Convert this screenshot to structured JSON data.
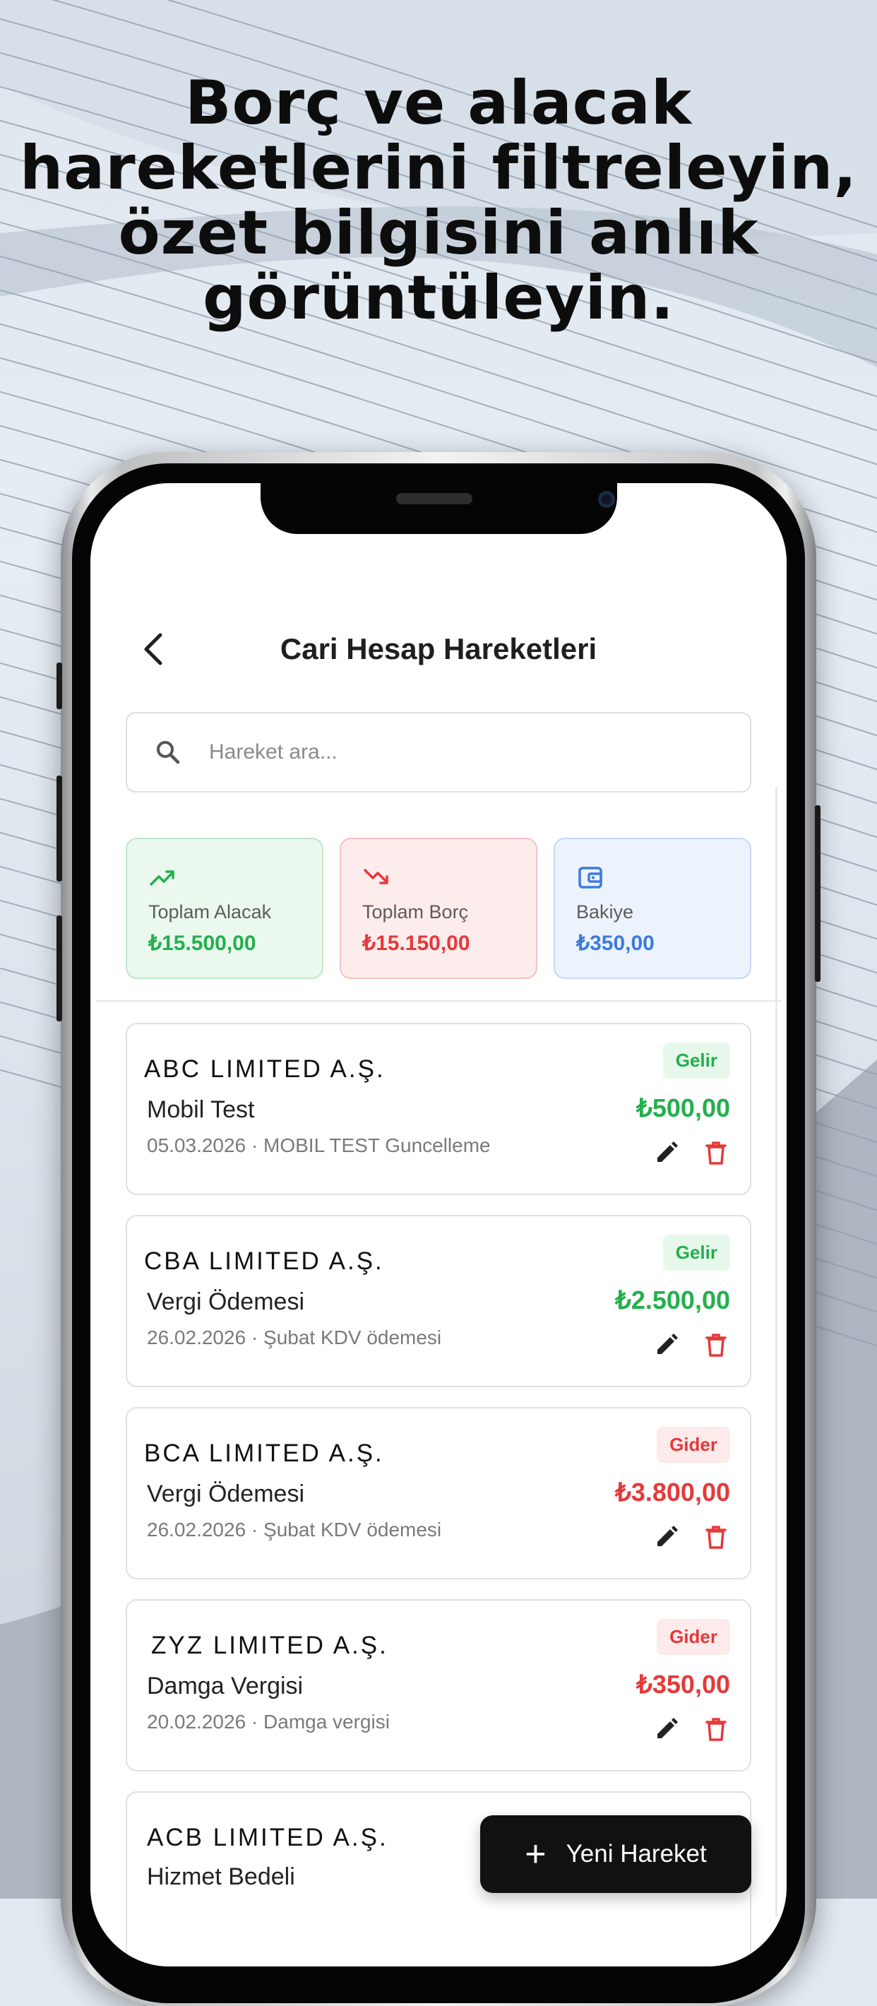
{
  "promo": {
    "headline_lines": [
      "Borç ve alacak",
      "hareketlerini filtreleyin,",
      "özet bilgisini anlık",
      "görüntüleyin."
    ]
  },
  "header": {
    "title": "Cari Hesap Hareketleri",
    "back_icon": "chevron-left-icon"
  },
  "search": {
    "placeholder": "Hareket ara...",
    "value": ""
  },
  "summary": [
    {
      "label": "Toplam Alacak",
      "value": "₺15.500,00",
      "icon": "trending-up-icon",
      "color": "#22b04b"
    },
    {
      "label": "Toplam Borç",
      "value": "₺15.150,00",
      "icon": "trending-down-icon",
      "color": "#e5393b"
    },
    {
      "label": "Bakiye",
      "value": "₺350,00",
      "icon": "wallet-icon",
      "color": "#3a7be0"
    }
  ],
  "transactions": [
    {
      "company": "ABC LIMITED A.Ş.",
      "title": "Mobil Test",
      "meta": "05.03.2026 · MOBIL TEST Guncelleme",
      "type": "Gelir",
      "amount": "₺500,00"
    },
    {
      "company": "CBA LIMITED A.Ş.",
      "title": "Vergi Ödemesi",
      "meta": "26.02.2026 · Şubat KDV ödemesi",
      "type": "Gelir",
      "amount": "₺2.500,00"
    },
    {
      "company": "BCA LIMITED A.Ş.",
      "title": "Vergi Ödemesi",
      "meta": "26.02.2026 · Şubat KDV ödemesi",
      "type": "Gider",
      "amount": "₺3.800,00"
    },
    {
      "company": "ZYZ LIMITED A.Ş.",
      "title": "Damga Vergisi",
      "meta": "20.02.2026 · Damga vergisi",
      "type": "Gider",
      "amount": "₺350,00"
    },
    {
      "company": "ACB LIMITED A.Ş.",
      "title": "Hizmet Bedeli",
      "meta": "",
      "type": "",
      "amount": ""
    }
  ],
  "fab": {
    "label": "Yeni Hareket",
    "icon": "plus-icon"
  },
  "colors": {
    "income": "#22b04b",
    "income_bg": "#e7f7ec",
    "expense": "#e5393b",
    "expense_bg": "#fdeaea",
    "balance": "#3a7be0",
    "delete_icon": "#e5393b",
    "fab_bg": "#111111"
  }
}
